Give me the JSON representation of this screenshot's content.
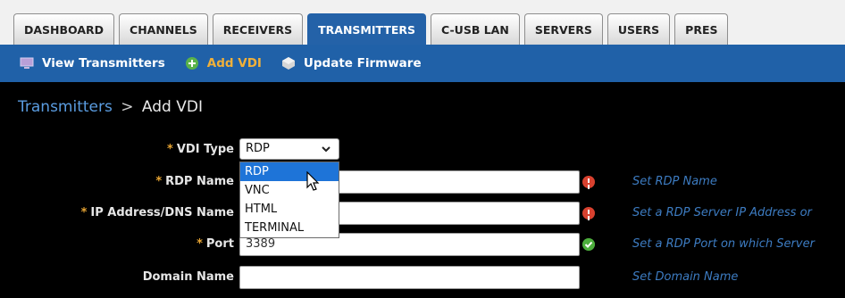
{
  "tabs": [
    "DASHBOARD",
    "CHANNELS",
    "RECEIVERS",
    "TRANSMITTERS",
    "C-USB LAN",
    "SERVERS",
    "USERS",
    "PRES"
  ],
  "active_tab_index": 3,
  "subnav": {
    "view": "View Transmitters",
    "add": "Add VDI",
    "firmware": "Update Firmware"
  },
  "breadcrumb": {
    "parent": "Transmitters",
    "separator": ">",
    "current": "Add VDI"
  },
  "form": {
    "vdi_type": {
      "label": "VDI Type",
      "value": "RDP",
      "options": [
        "RDP",
        "VNC",
        "HTML",
        "TERMINAL"
      ],
      "highlighted": "RDP"
    },
    "rdp_name": {
      "label": "RDP Name",
      "value": "",
      "hint": "Set RDP Name"
    },
    "ip": {
      "label": "IP Address/DNS Name",
      "value": "",
      "hint": "Set a RDP Server IP Address or"
    },
    "port": {
      "label": "Port",
      "value": "3389",
      "hint": "Set a RDP Port on which Server"
    },
    "domain": {
      "label": "Domain Name",
      "value": "",
      "hint": "Set Domain Name"
    }
  },
  "colors": {
    "active_tab": "#2462a8",
    "subnav_bg": "#2061a8",
    "accent": "#f0b03a",
    "link": "#5a9ce0",
    "hint": "#3d7cc2"
  }
}
